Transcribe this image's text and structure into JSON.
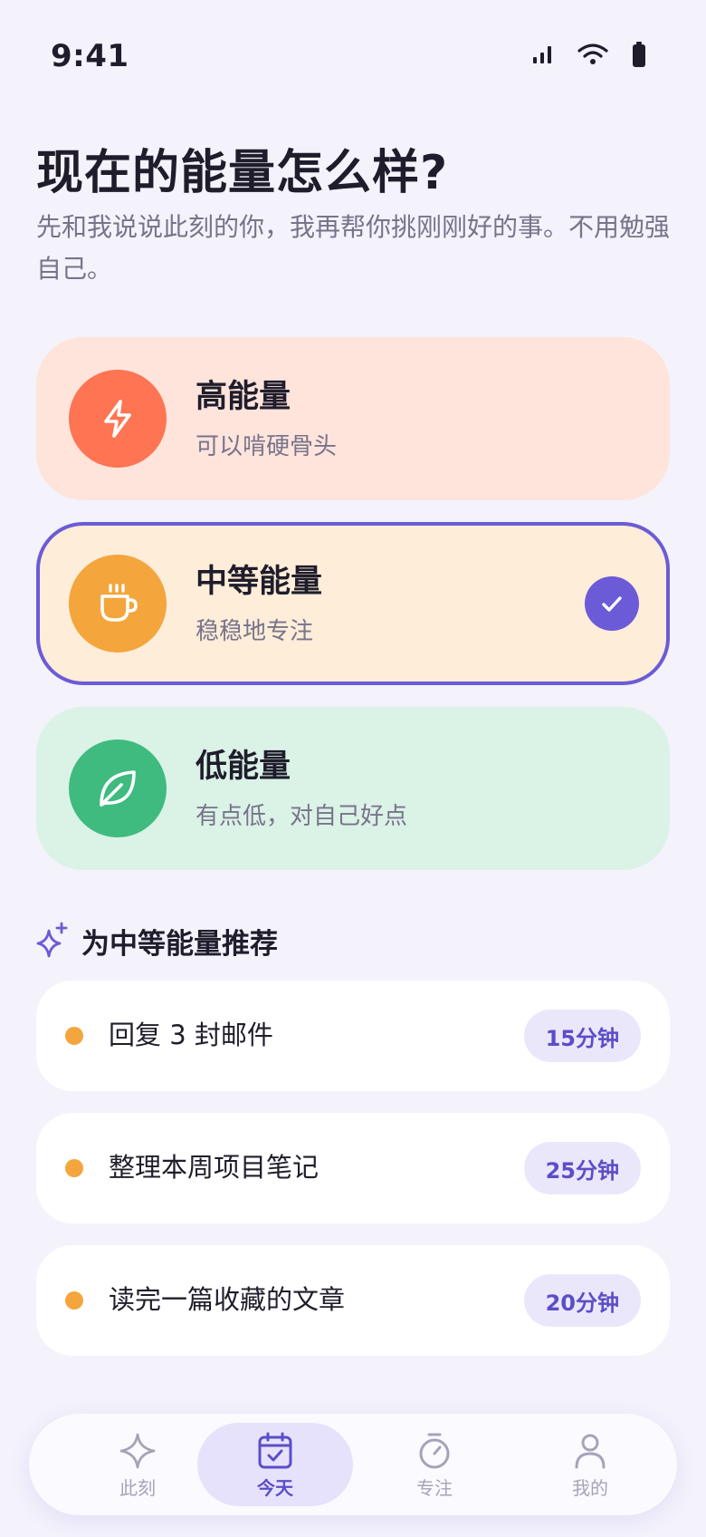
{
  "status_bar": {
    "time": "9:41"
  },
  "header": {
    "title": "现在的能量怎么样?",
    "subtitle": "先和我说说此刻的你，我再帮你挑刚刚好的事。不用勉强自己。"
  },
  "energy_options": [
    {
      "label": "高能量",
      "description": "可以啃硬骨头",
      "icon": "lightning-icon",
      "color": "#ff7452",
      "selected": false
    },
    {
      "label": "中等能量",
      "description": "稳稳地专注",
      "icon": "coffee-cup-icon",
      "color": "#f4a53c",
      "selected": true
    },
    {
      "label": "低能量",
      "description": "有点低，对自己好点",
      "icon": "leaf-icon",
      "color": "#3fbb7f",
      "selected": false
    }
  ],
  "recommendations": {
    "title": "为中等能量推荐",
    "icon": "sparkles-icon",
    "items": [
      {
        "label": "回复 3 封邮件",
        "duration": "15分钟"
      },
      {
        "label": "整理本周项目笔记",
        "duration": "25分钟"
      },
      {
        "label": "读完一篇收藏的文章",
        "duration": "20分钟"
      }
    ]
  },
  "tab_bar": {
    "active": "今天",
    "tabs": [
      {
        "label": "此刻",
        "icon": "sparkle-icon"
      },
      {
        "label": "今天",
        "icon": "calendar-check-icon"
      },
      {
        "label": "专注",
        "icon": "stopwatch-icon"
      },
      {
        "label": "我的",
        "icon": "person-icon"
      }
    ]
  },
  "colors": {
    "accent": "#6b5bd6",
    "background": "#f4f2fb"
  }
}
